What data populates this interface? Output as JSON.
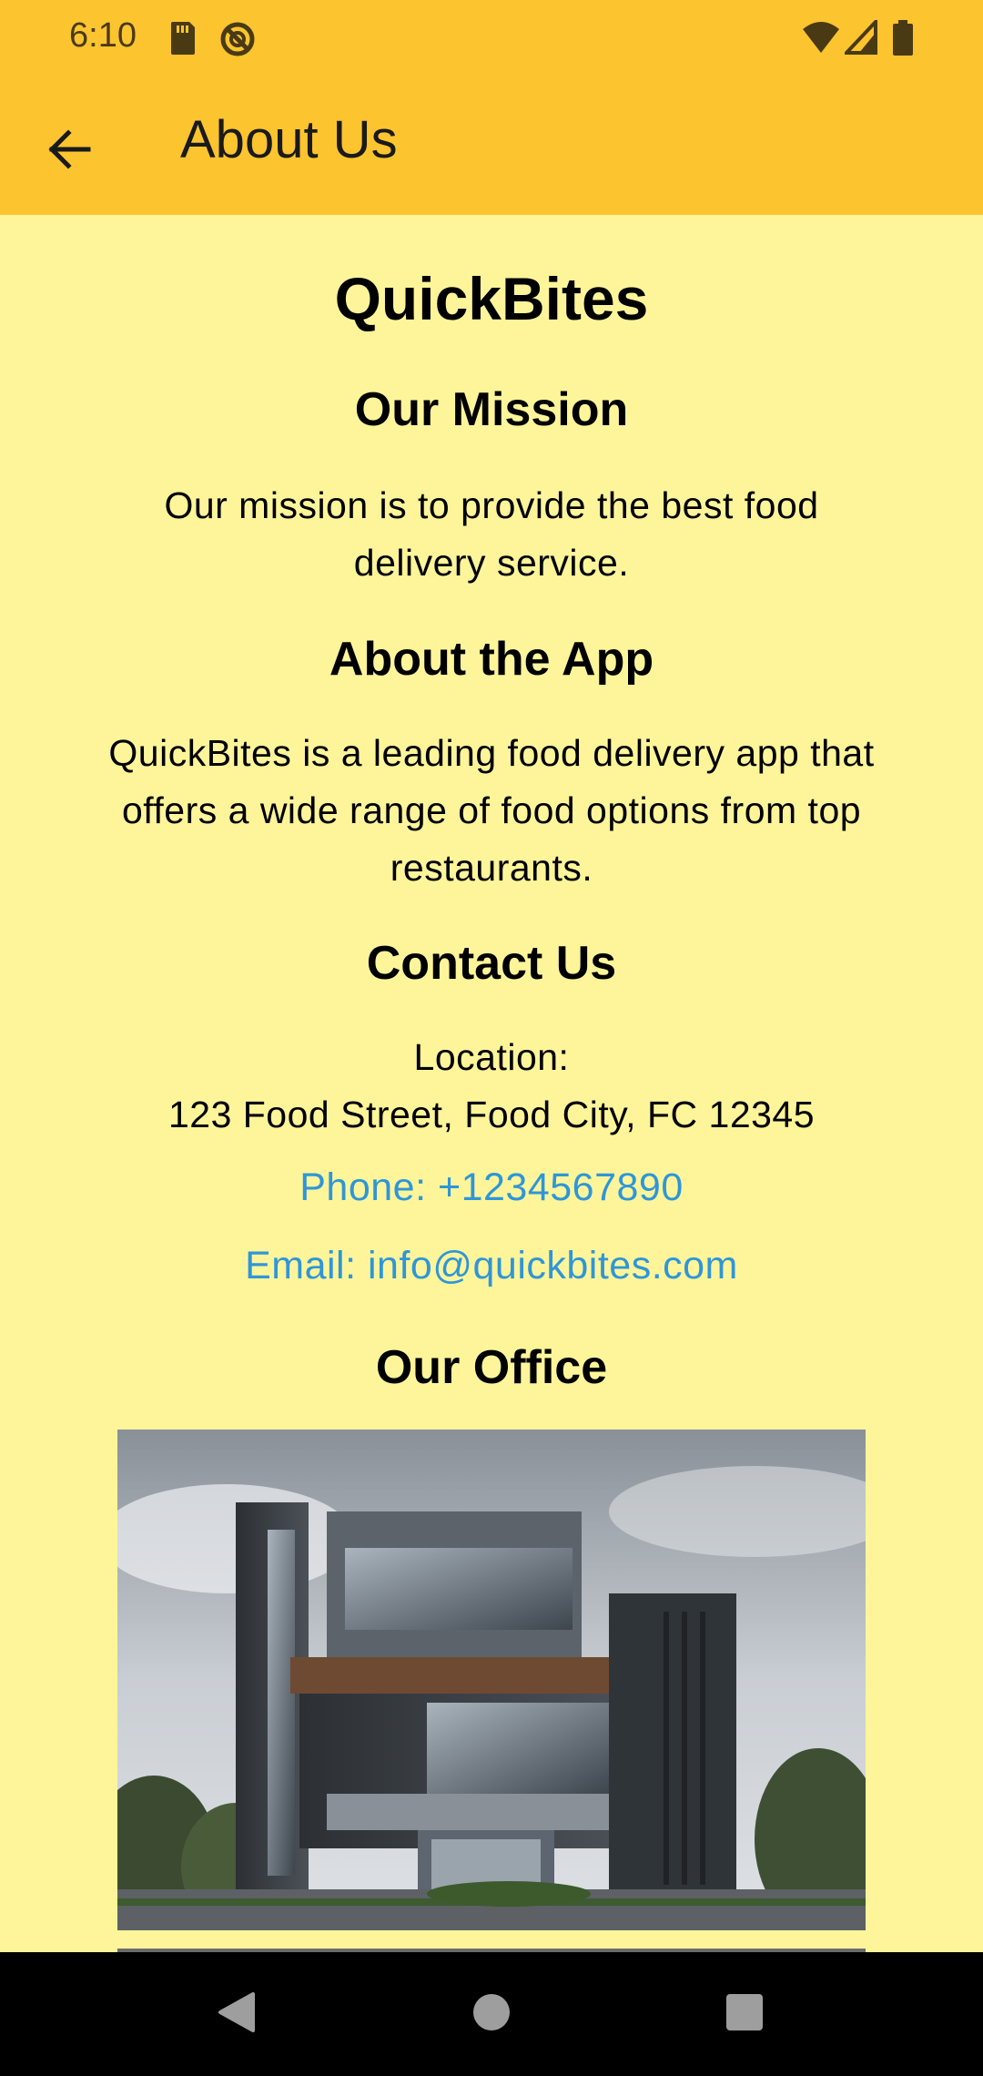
{
  "status_bar": {
    "time": "6:10",
    "icons": [
      "sd-card-icon",
      "sync-off-icon",
      "wifi-icon",
      "cellular-signal-icon",
      "battery-icon"
    ]
  },
  "app_bar": {
    "title": "About Us",
    "back_icon": "arrow-back-icon"
  },
  "content": {
    "app_name": "QuickBites",
    "mission": {
      "title": "Our Mission",
      "text_line1": "Our mission is to provide the best food",
      "text_line2": "delivery service."
    },
    "about_app": {
      "title": "About the App",
      "text_line1": "QuickBites is a leading food delivery app that",
      "text_line2": "offers a wide range of food options from top",
      "text_line3": "restaurants."
    },
    "contact": {
      "title": "Contact Us",
      "location_label": "Location:",
      "location_value": "123 Food Street, Food City, FC 12345",
      "phone": "Phone: +1234567890",
      "email": "Email: info@quickbites.com"
    },
    "office": {
      "title": "Our Office"
    }
  },
  "colors": {
    "app_bar": "#FCC42E",
    "background": "#FEF59A",
    "link": "#2E96D8",
    "nav_bar": "#000000"
  },
  "nav_bar": {
    "icons": [
      "back-triangle-icon",
      "home-circle-icon",
      "recents-square-icon"
    ]
  }
}
